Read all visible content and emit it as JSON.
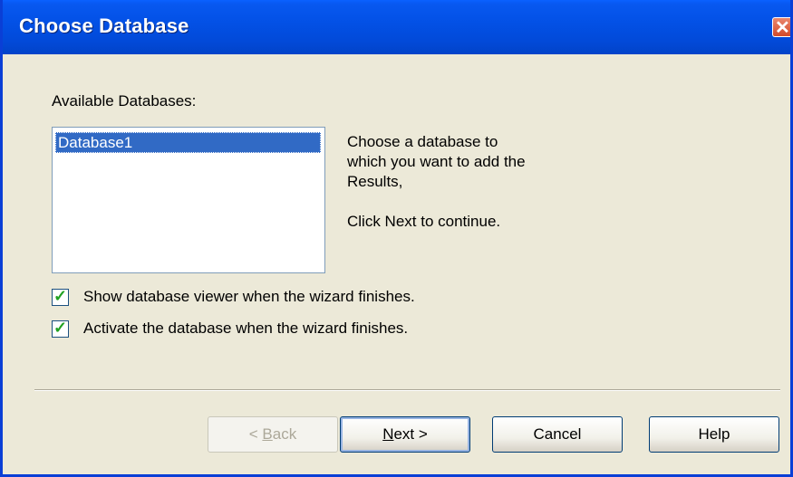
{
  "window": {
    "title": "Choose Database",
    "close_glyph": "✕"
  },
  "available_label": "Available Databases:",
  "databases": [
    {
      "name": "Database1",
      "selected": true
    }
  ],
  "description": {
    "line1": "Choose a database to",
    "line2": "which you want to add the",
    "line3": "Results,",
    "line4": "Click Next to continue."
  },
  "options": {
    "show_viewer": {
      "label": "Show database viewer when the wizard finishes.",
      "checked": true
    },
    "activate_db": {
      "label": "Activate the database when the wizard finishes.",
      "checked": true
    }
  },
  "buttons": {
    "back": {
      "prefix": "< ",
      "accel": "B",
      "rest": "ack",
      "enabled": false
    },
    "next": {
      "accel": "N",
      "rest": "ext >",
      "enabled": true,
      "default": true
    },
    "cancel": {
      "label": "Cancel"
    },
    "help": {
      "label": "Help"
    }
  },
  "colors": {
    "titlebar": "#0351e6",
    "dialog_bg": "#ece9d8",
    "selection": "#316ac5",
    "checkmark": "#21a121"
  }
}
